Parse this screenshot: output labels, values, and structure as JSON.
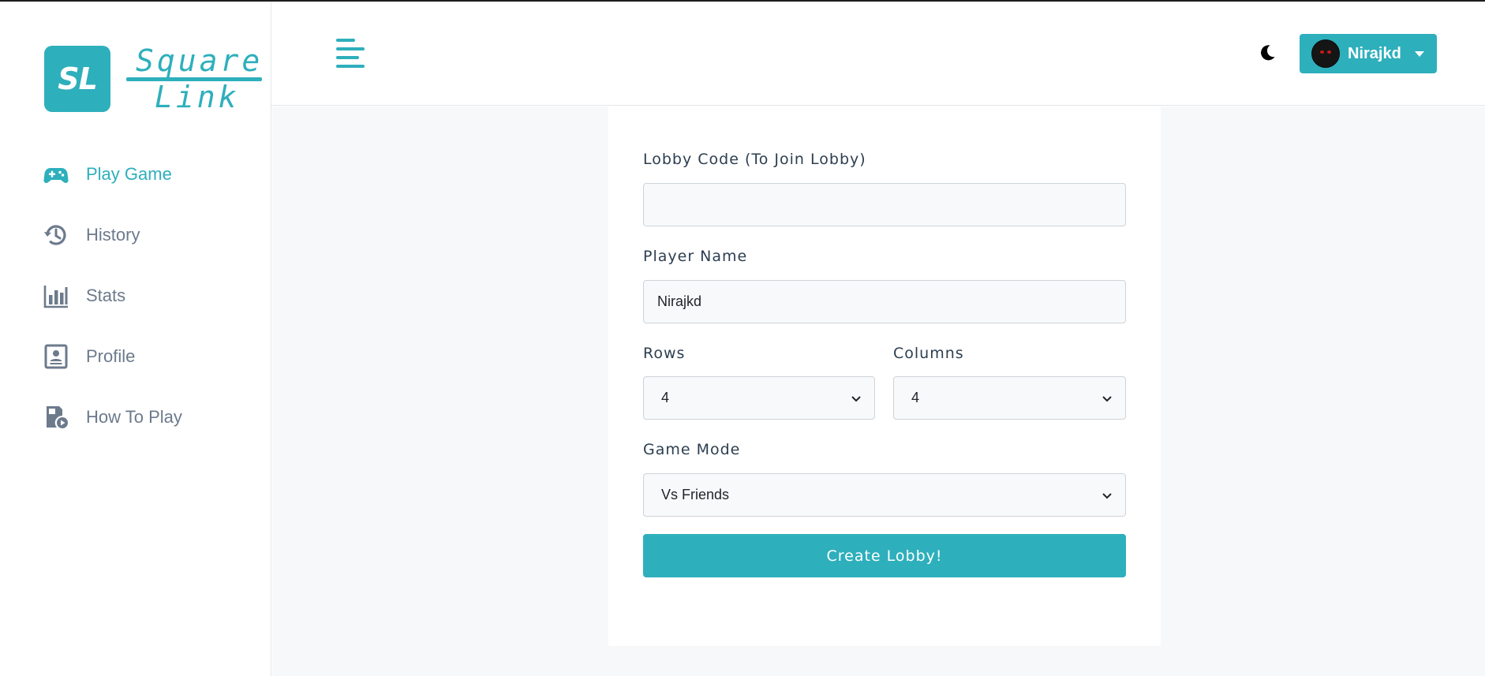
{
  "brand": {
    "badge": "SL",
    "word1": "Square",
    "word2": "Link",
    "accent_color": "#2eafbc"
  },
  "sidebar": {
    "items": [
      {
        "label": "Play Game",
        "icon": "gamepad-icon",
        "active": true
      },
      {
        "label": "History",
        "icon": "history-icon",
        "active": false
      },
      {
        "label": "Stats",
        "icon": "bar-chart-icon",
        "active": false
      },
      {
        "label": "Profile",
        "icon": "profile-card-icon",
        "active": false
      },
      {
        "label": "How To Play",
        "icon": "tutorial-play-icon",
        "active": false
      }
    ]
  },
  "header": {
    "menu_icon": "hamburger-menu-icon",
    "theme_icon": "moon-icon",
    "user": {
      "name": "Nirajkd",
      "avatar_icon": "avatar-image",
      "caret_icon": "caret-down-icon"
    }
  },
  "form": {
    "lobby_code": {
      "label": "Lobby Code (To Join Lobby)",
      "value": ""
    },
    "player_name": {
      "label": "Player Name",
      "value": "Nirajkd"
    },
    "rows": {
      "label": "Rows",
      "value": "4"
    },
    "columns": {
      "label": "Columns",
      "value": "4"
    },
    "game_mode": {
      "label": "Game Mode",
      "value": "Vs Friends"
    },
    "submit_label": "Create Lobby!"
  }
}
